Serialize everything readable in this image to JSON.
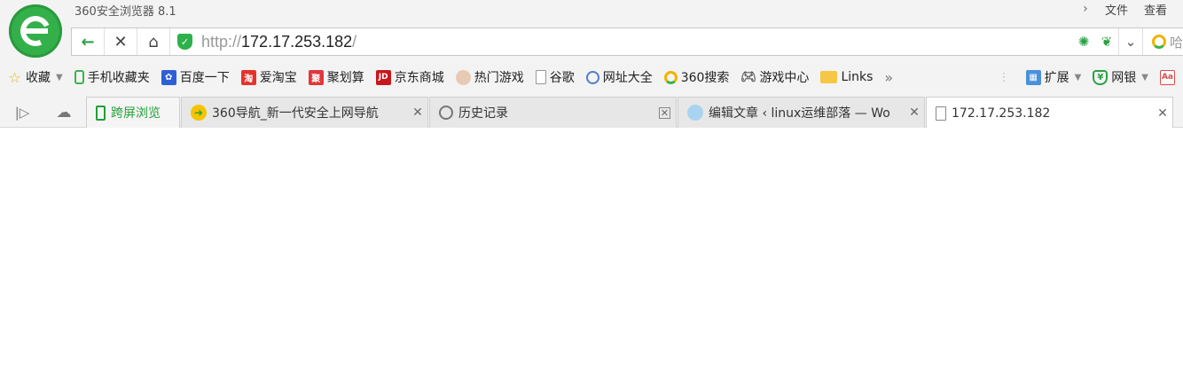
{
  "window": {
    "title": "360安全浏览器 8.1"
  },
  "menu": {
    "chevron": "›",
    "items": [
      "文件",
      "查看"
    ]
  },
  "nav": {
    "back": "←",
    "stop": "✕",
    "home": "⌂",
    "url_scheme": "http://",
    "url_host": "172.17.253.182",
    "url_tail": "/",
    "search_hint": "哈",
    "dropdown": "⌄"
  },
  "bookmarks": {
    "items": [
      {
        "label": "收藏",
        "icon": "star-icon"
      },
      {
        "label": "手机收藏夹",
        "icon": "phone-icon"
      },
      {
        "label": "百度一下",
        "icon": "baidu-paw-icon"
      },
      {
        "label": "爱淘宝",
        "icon": "taobao-icon",
        "glyph": "淘"
      },
      {
        "label": "聚划算",
        "icon": "juhuasuan-icon",
        "glyph": "聚"
      },
      {
        "label": "京东商城",
        "icon": "jd-icon",
        "glyph": "JD"
      },
      {
        "label": "热门游戏",
        "icon": "game-avatar-icon"
      },
      {
        "label": "谷歌",
        "icon": "page-icon"
      },
      {
        "label": "网址大全",
        "icon": "globe-icon"
      },
      {
        "label": "360搜索",
        "icon": "search-360-icon"
      },
      {
        "label": "游戏中心",
        "icon": "gamepad-icon"
      },
      {
        "label": "Links",
        "icon": "folder-icon"
      }
    ],
    "more": "»",
    "right": [
      {
        "label": "扩展",
        "icon": "extension-icon"
      },
      {
        "label": "网银",
        "icon": "bank-shield-icon",
        "glyph": "¥"
      }
    ]
  },
  "tabs": [
    {
      "label": "跨屏浏览",
      "icon": "phone-icon"
    },
    {
      "label": "360导航_新一代安全上网导航",
      "icon": "360-nav-icon"
    },
    {
      "label": "历史记录",
      "icon": "clock-icon"
    },
    {
      "label": "编辑文章 ‹ linux运维部落 — Wo",
      "icon": "wordpress-icon"
    },
    {
      "label": "172.17.253.182",
      "icon": "page-icon"
    }
  ],
  "colors": {
    "brand_green": "#2aa242",
    "accent_orange": "#f0b400"
  }
}
